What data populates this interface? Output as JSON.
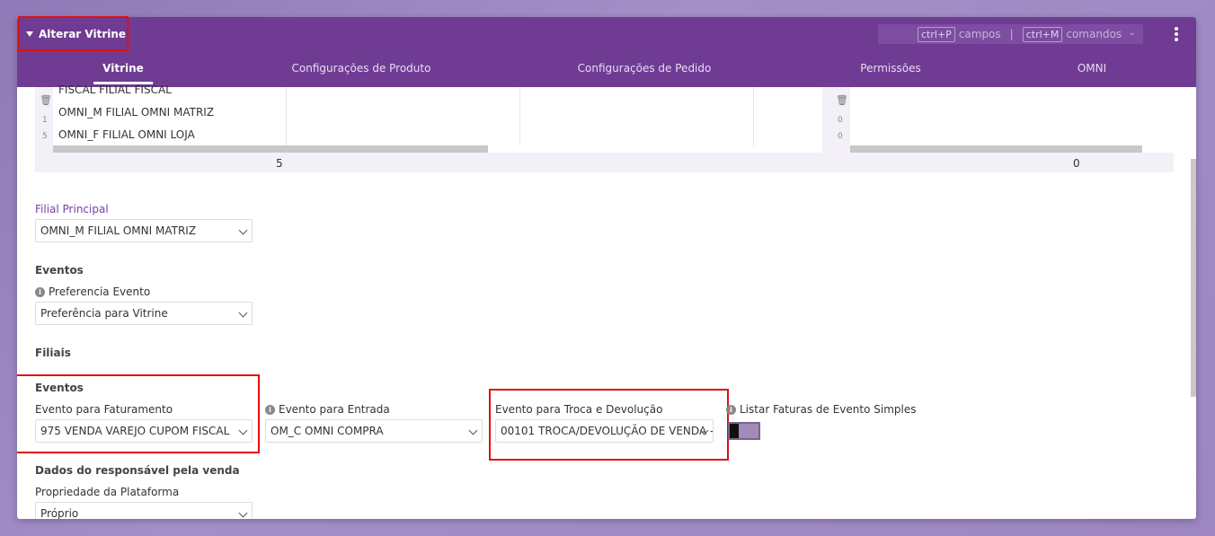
{
  "header": {
    "title": "Alterar Vitrine",
    "shortcut1_key": "ctrl+P",
    "shortcut1_label": "campos",
    "separator": "|",
    "shortcut2_key": "ctrl+M",
    "shortcut2_label": "comandos"
  },
  "tabs": [
    {
      "label": "Vitrine"
    },
    {
      "label": "Configurações de Produto"
    },
    {
      "label": "Configurações de Pedido"
    },
    {
      "label": "Permissões"
    },
    {
      "label": "OMNI"
    }
  ],
  "grid_left": {
    "rows": [
      "FISCAL FILIAL FISCAL",
      "OMNI_M FILIAL OMNI MATRIZ",
      "OMNI_F FILIAL OMNI LOJA"
    ],
    "row_index_1": "1",
    "row_index_2": "5",
    "count": "5"
  },
  "grid_right": {
    "row_index_1": "0",
    "row_index_2": "0",
    "count": "0"
  },
  "filial_principal": {
    "label": "Filial Principal",
    "value": "OMNI_M FILIAL OMNI MATRIZ"
  },
  "eventos": {
    "title": "Eventos",
    "preferencia_label": "Preferencia Evento",
    "preferencia_value": "Preferência para Vitrine"
  },
  "filiais": {
    "title": "Filiais",
    "eventos_title": "Eventos",
    "faturamento_label": "Evento para Faturamento",
    "faturamento_value": "975 VENDA VAREJO CUPOM FISCAL",
    "entrada_label": "Evento para Entrada",
    "entrada_value": "OM_C OMNI COMPRA",
    "troca_label": "Evento para Troca e Devolução",
    "troca_value": "00101 TROCA/DEVOLUÇÃO DE VENDA -",
    "listar_label": "Listar Faturas de Evento Simples"
  },
  "responsavel": {
    "title": "Dados do responsável pela venda",
    "propriedade_label": "Propriedade da Plataforma",
    "propriedade_value": "Próprio"
  },
  "colors": {
    "header": "#6f3b93",
    "accent_red": "#e01010",
    "label_purple": "#7a3da6"
  }
}
